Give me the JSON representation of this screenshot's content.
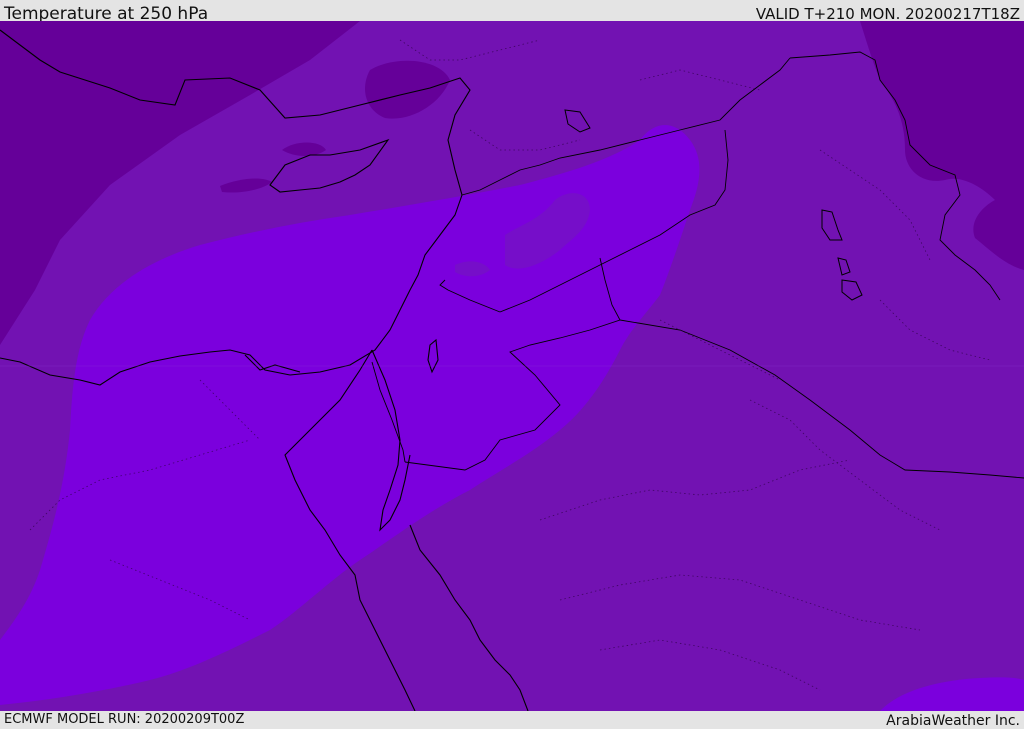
{
  "header": {
    "title": "Temperature at 250 hPa",
    "valid_time": "VALID T+210 MON. 20200217T18Z"
  },
  "footer": {
    "model_run": "ECMWF MODEL RUN: 20200209T00Z",
    "credit": "ArabiaWeather Inc."
  },
  "map": {
    "field": "temperature",
    "level": "250 hPa",
    "colors": {
      "deep_purple": "#650099",
      "purple": "#7212b2",
      "violet": "#7b00dd",
      "coastline": "#000000"
    }
  }
}
